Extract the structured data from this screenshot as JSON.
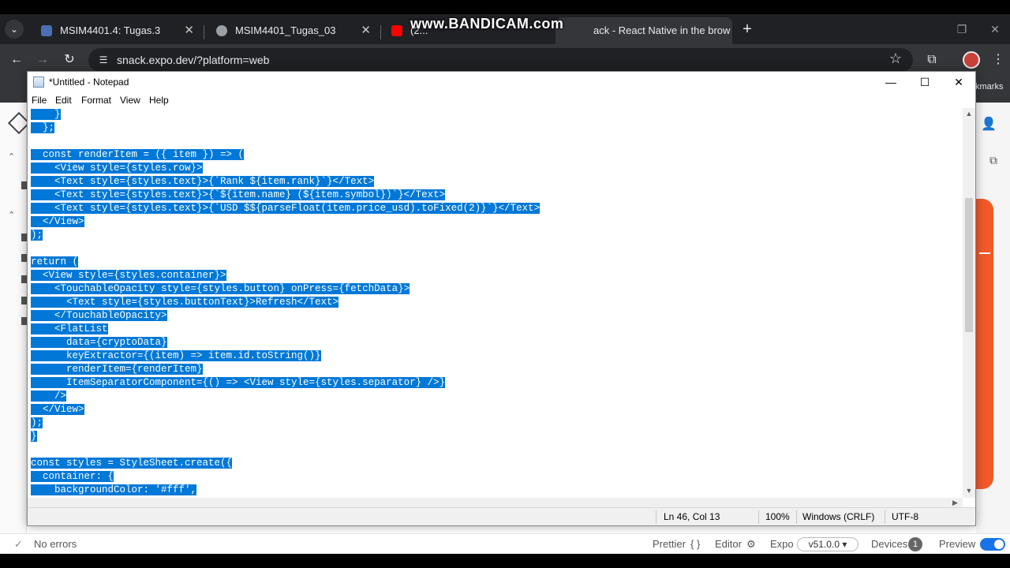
{
  "tabs": [
    {
      "title": "MSIM4401.4: Tugas.3",
      "favicon_color": "#4a6fb5"
    },
    {
      "title": "MSIM4401_Tugas_03",
      "favicon_color": "#9aa0a6"
    },
    {
      "title": "(2...",
      "favicon_color": "#ff0000"
    },
    {
      "title": "ack - React Native in the brow",
      "favicon_color": "#9aa0a6"
    }
  ],
  "watermark": "www.BANDICAM.com",
  "browser": {
    "url": "snack.expo.dev/?platform=web",
    "bookmarks_label": "kmarks"
  },
  "notepad": {
    "title": "*Untitled - Notepad",
    "menu": [
      "File",
      "Edit",
      "Format",
      "View",
      "Help"
    ],
    "lines": [
      "    }",
      "  };",
      "",
      "  const renderItem = ({ item }) => (",
      "    <View style={styles.row}>",
      "    <Text style={styles.text}>{`Rank ${item.rank}`}</Text>",
      "    <Text style={styles.text}>{`${item.name} (${item.symbol})`}</Text>",
      "    <Text style={styles.text}>{`USD $${parseFloat(item.price_usd).toFixed(2)}`}</Text>",
      "  </View>",
      ");",
      "",
      "return (",
      "  <View style={styles.container}>",
      "    <TouchableOpacity style={styles.button} onPress={fetchData}>",
      "      <Text style={styles.buttonText}>Refresh</Text>",
      "    </TouchableOpacity>",
      "    <FlatList",
      "      data={cryptoData}",
      "      keyExtractor={(item) => item.id.toString()}",
      "      renderItem={renderItem}",
      "      ItemSeparatorComponent={() => <View style={styles.separator} />}",
      "    />",
      "  </View>",
      ");",
      "}",
      "",
      "const styles = StyleSheet.create({",
      "  container: {",
      "    backgroundColor: '#fff',"
    ],
    "status": {
      "position": "Ln 46, Col 13",
      "zoom": "100%",
      "line_ending": "Windows (CRLF)",
      "encoding": "UTF-8"
    },
    "selection_color": "#0078d7"
  },
  "snack_status": {
    "errors": "No errors",
    "prettier": "Prettier",
    "prettier_braces": "{ }",
    "editor": "Editor",
    "expo": "Expo",
    "version": "v51.0.0 ▾",
    "devices": "Devices",
    "devices_count": "1",
    "preview": "Preview"
  },
  "accent_orange": "#f25a2a"
}
